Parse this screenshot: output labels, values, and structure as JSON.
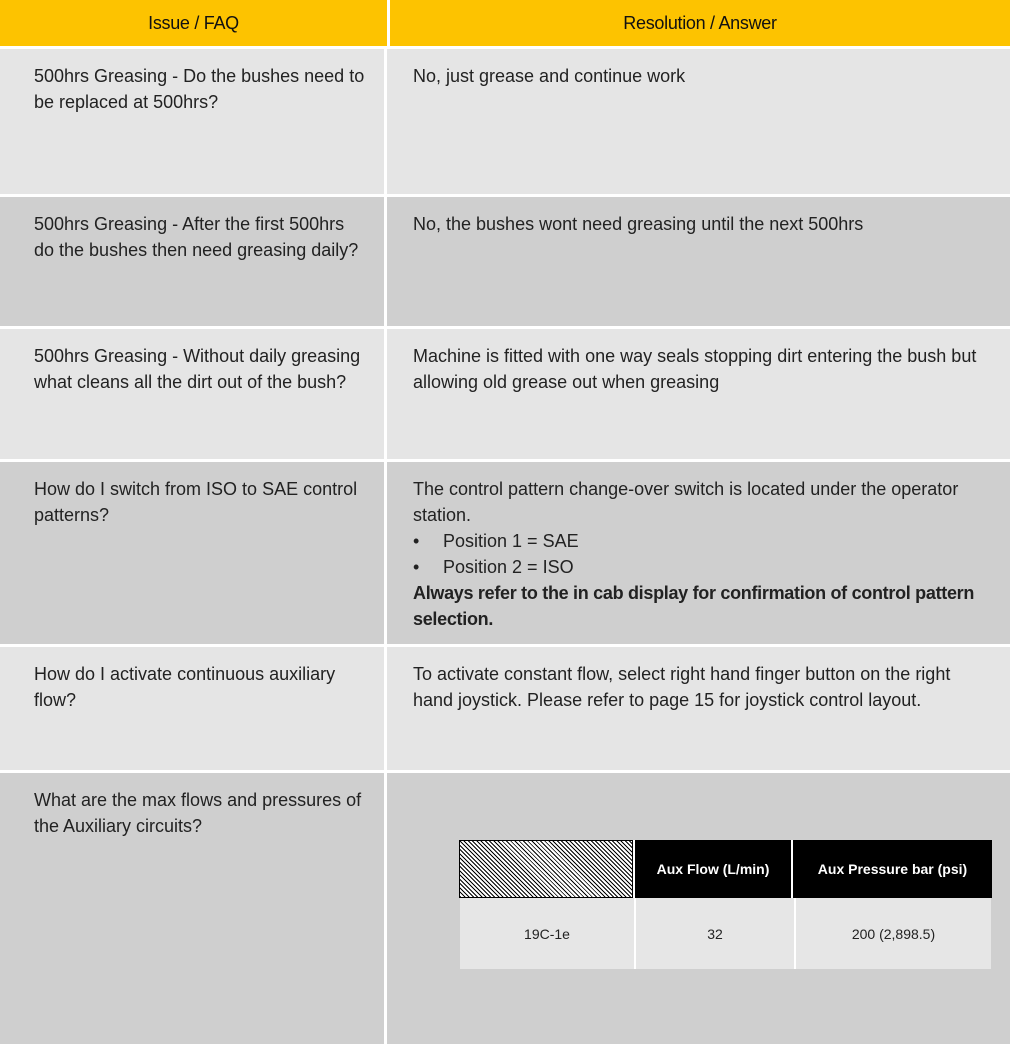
{
  "header": {
    "issue_label": "Issue / FAQ",
    "resolution_label": "Resolution / Answer",
    "accent_color": "#fdc300"
  },
  "rows": [
    {
      "question": "500hrs Greasing - Do the bushes need to be replaced at 500hrs?",
      "answer": "No, just grease and continue work"
    },
    {
      "question": "500hrs Greasing - After the first 500hrs do the bushes then need greasing daily?",
      "answer": "No, the bushes wont need greasing until the next 500hrs"
    },
    {
      "question": "500hrs Greasing - Without daily greasing what cleans all the dirt out of the bush?",
      "answer": "Machine is fitted with one way seals stopping dirt entering the bush but allowing old grease out when greasing"
    },
    {
      "question": "How do I switch from ISO to SAE control patterns?",
      "answer": "The control pattern change-over switch is located under the operator station.",
      "bullets": [
        "Position 1 = SAE",
        "Position 2 = ISO"
      ],
      "note": "Always refer to the in cab display for confirmation of control pattern selection."
    },
    {
      "question": "How do I activate continuous auxiliary flow?",
      "answer": "To activate constant flow, select right hand finger button on the right hand joystick. Please refer to page 15 for joystick control layout."
    },
    {
      "question": "What are the max flows and pressures of the Auxiliary circuits?",
      "answer": ""
    }
  ],
  "aux_table": {
    "headers": [
      "",
      "Aux Flow (L/min)",
      "Aux Pressure  bar (psi)"
    ],
    "row": [
      "19C-1e",
      "32",
      "200 (2,898.5)"
    ]
  }
}
